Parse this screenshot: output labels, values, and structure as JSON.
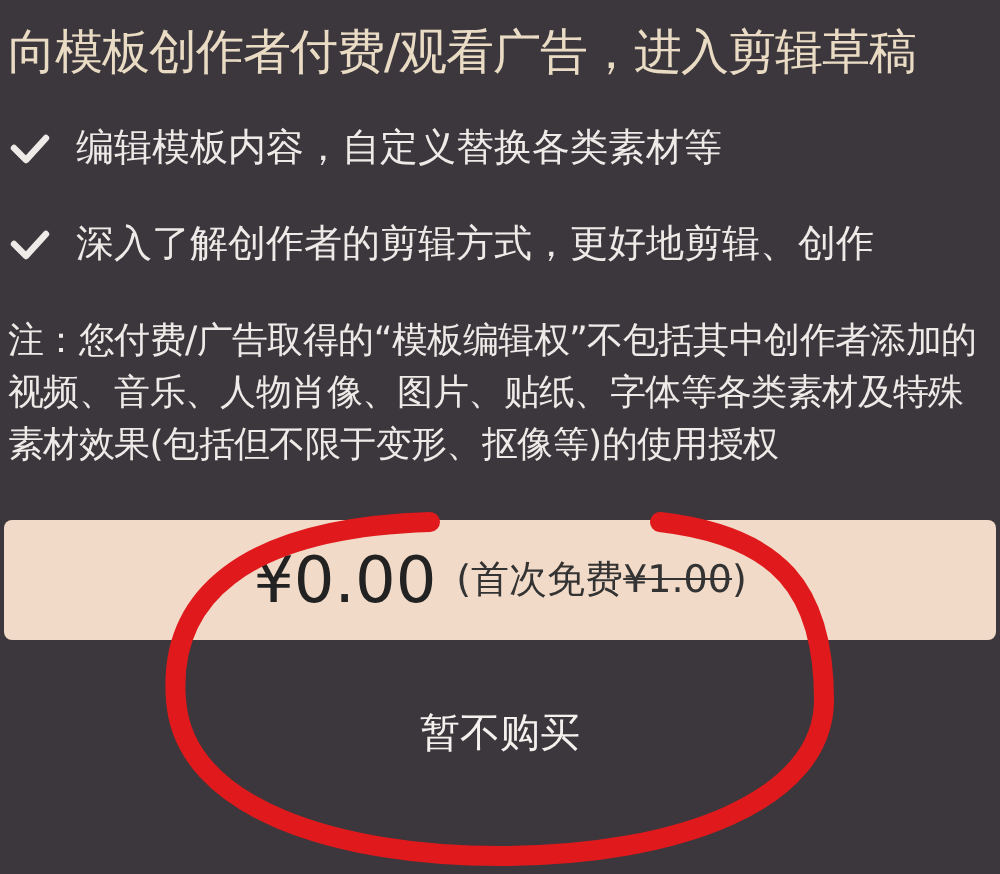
{
  "title": "向模板创作者付费/观看广告，进入剪辑草稿",
  "benefits": [
    {
      "text": "编辑模板内容，自定义替换各类素材等",
      "checked": true
    },
    {
      "text": "深入了解创作者的剪辑方式，更好地剪辑、创作",
      "checked": true
    }
  ],
  "notice": "注：您付费/广告取得的“模板编辑权”不包括其中创作者添加的视频、音乐、人物肖像、图片、贴纸、字体等各类素材及特殊素材效果(包括但不限于变形、抠像等)的使用授权",
  "buy_button": {
    "price": "¥0.00",
    "note_prefix": "(首次免费",
    "original_price": "¥1.00",
    "note_suffix": ")"
  },
  "skip_button": "暂不购买"
}
